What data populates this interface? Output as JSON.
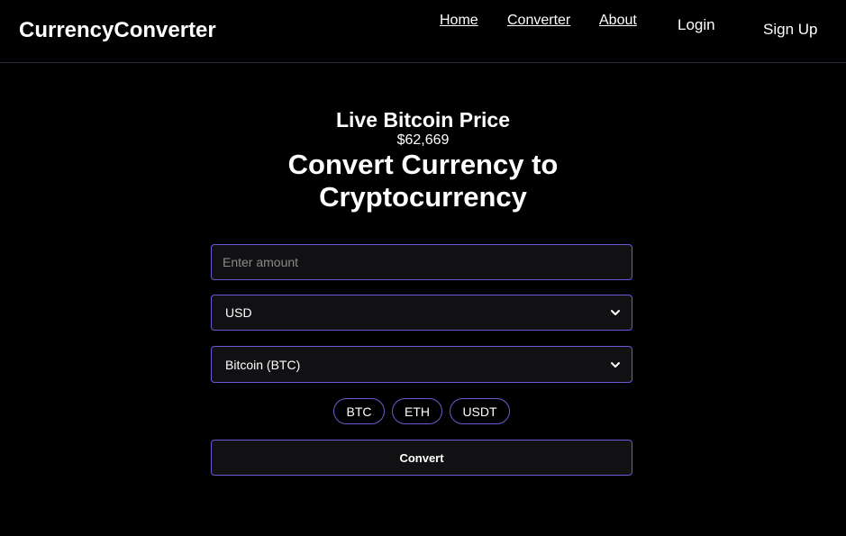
{
  "header": {
    "brand": "CurrencyConverter",
    "nav": {
      "home": "Home",
      "converter": "Converter",
      "about": "About"
    },
    "login": "Login",
    "signup": "Sign Up"
  },
  "hero": {
    "live_title": "Live Bitcoin Price",
    "live_price": "$62,669",
    "heading_line1": "Convert Currency to",
    "heading_line2": "Cryptocurrency"
  },
  "form": {
    "amount_placeholder": "Enter amount",
    "amount_value": "",
    "from_currency": "USD",
    "to_currency": "Bitcoin (BTC)",
    "quick_picks": [
      "BTC",
      "ETH",
      "USDT"
    ],
    "convert_label": "Convert"
  },
  "colors": {
    "background": "#000000",
    "accent_border": "#6a5acd",
    "field_bg": "#111114"
  },
  "icons": {
    "select_chevron": "chevron-down-icon"
  }
}
